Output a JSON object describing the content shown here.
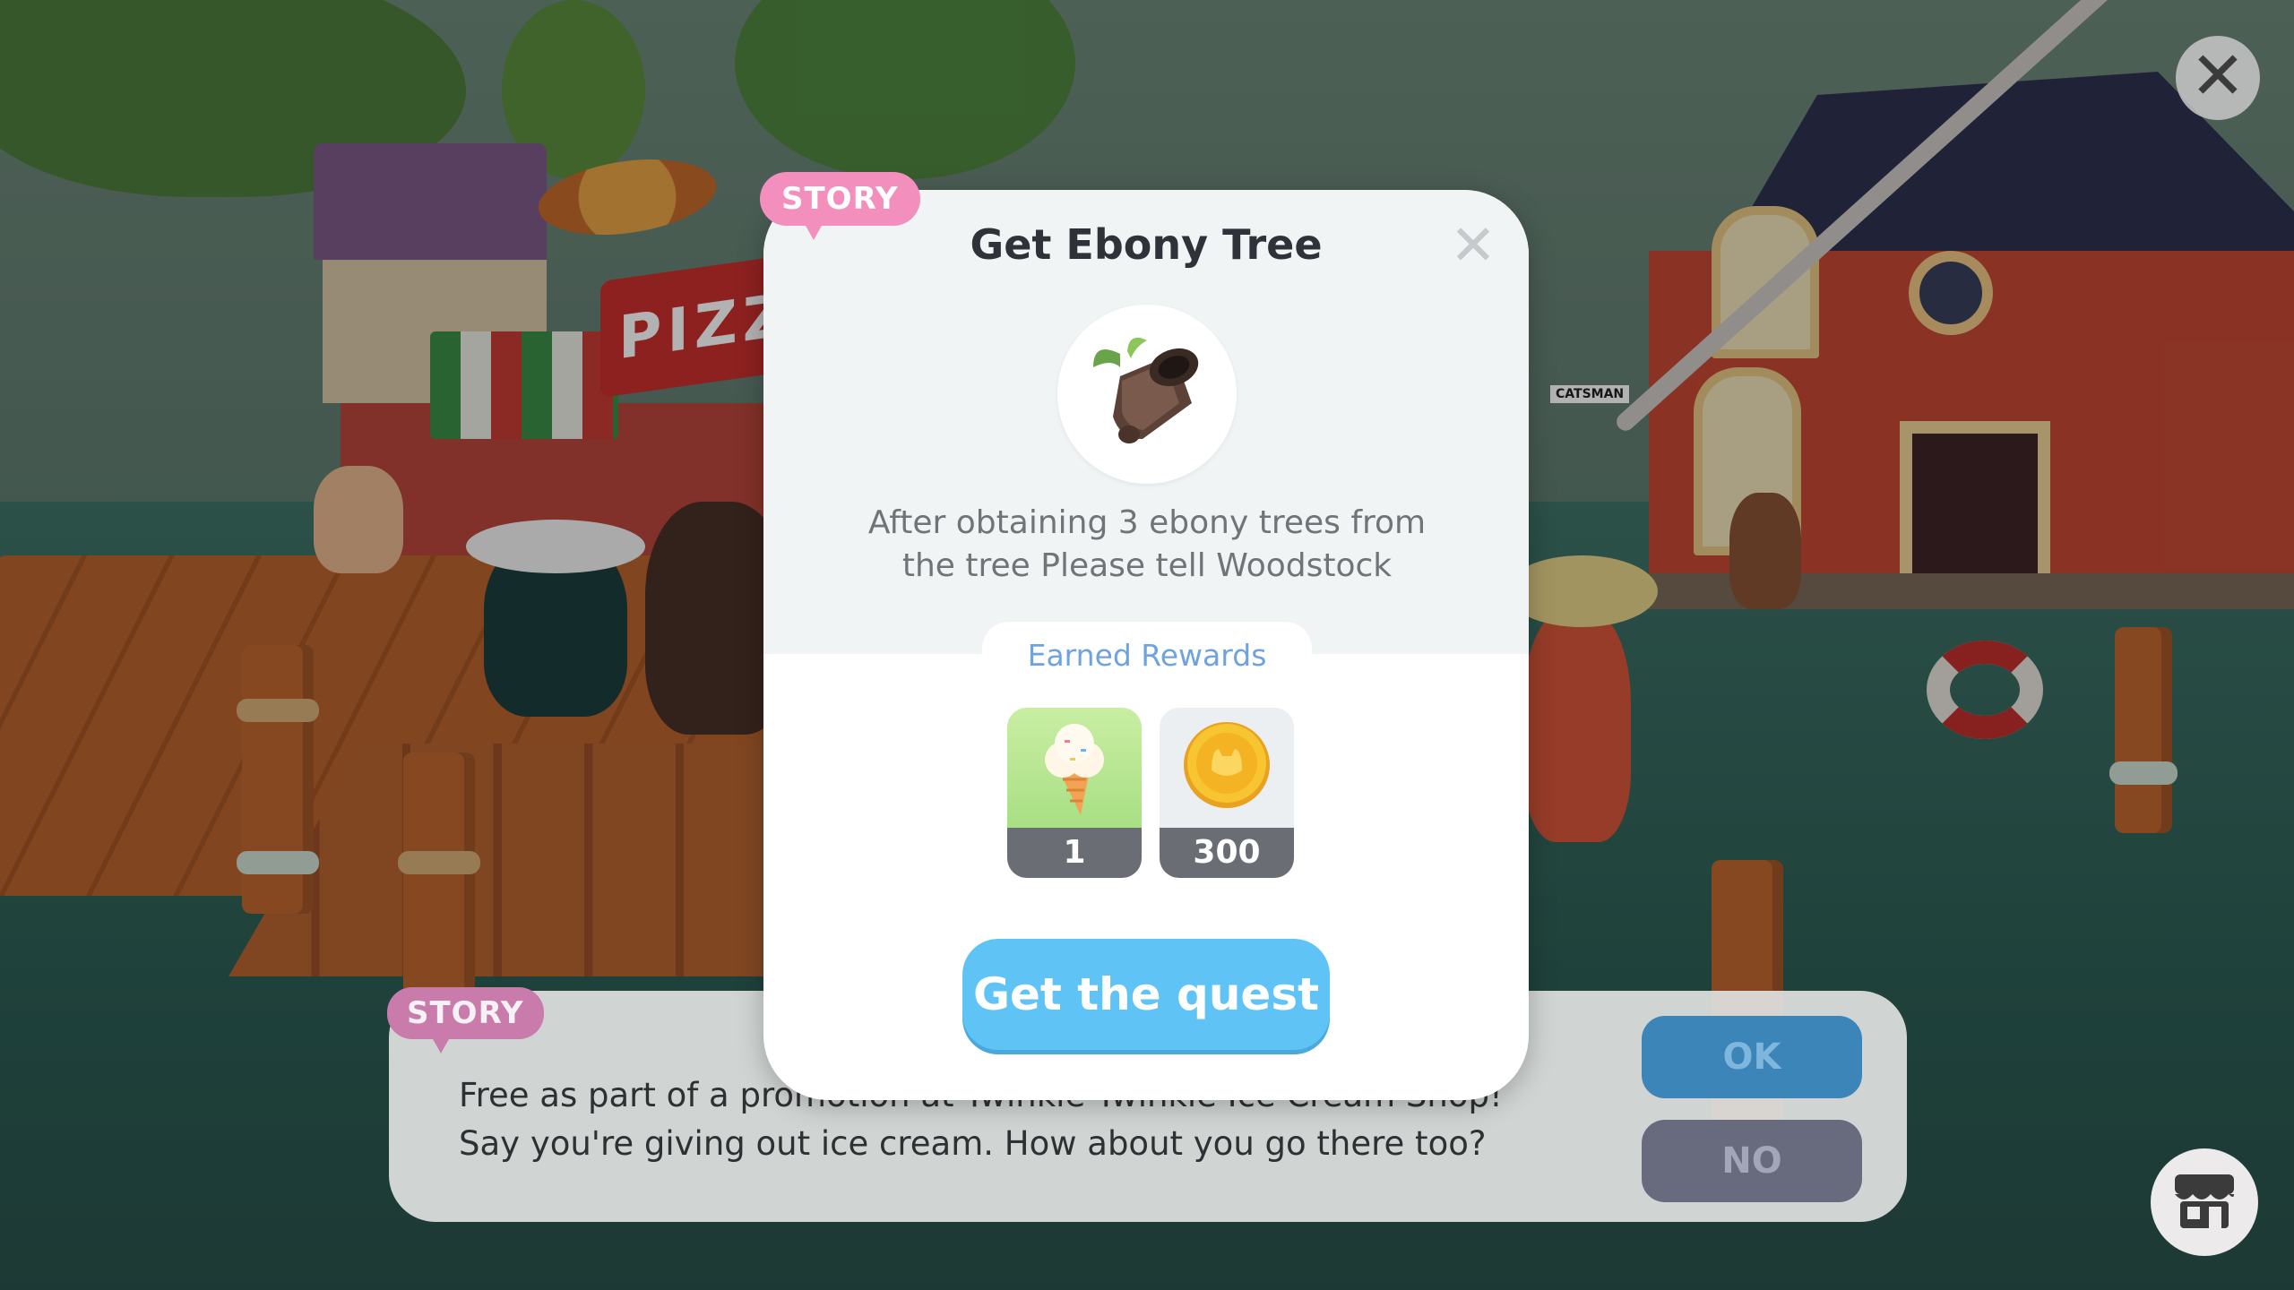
{
  "hud": {
    "close_icon": "close-icon",
    "shop_icon": "shop-icon"
  },
  "modal": {
    "tag": "STORY",
    "title": "Get Ebony Tree",
    "item_icon": "ebony-log-icon",
    "description_line1": "After obtaining 3 ebony trees from",
    "description_line2": "the tree Please tell Woodstock",
    "rewards_label": "Earned Rewards",
    "rewards": [
      {
        "icon": "ice-cream-icon",
        "count": "1"
      },
      {
        "icon": "gold-coin-icon",
        "count": "300"
      }
    ],
    "button_label": "Get the quest"
  },
  "story_dialog": {
    "tag": "STORY",
    "line1": "Free as part of a promotion at Twinkle Twinkle Ice Cream Shop!",
    "line2": "Say you're giving out ice cream. How about you go there too?",
    "ok_label": "OK",
    "no_label": "NO"
  },
  "scene": {
    "pizza_sign": "PIZZ",
    "shop_sign": "CATSMAN"
  },
  "colors": {
    "accent_blue": "#5fc3f5",
    "story_pink": "#f38fbd",
    "rewards_blue": "#6ea3e0"
  }
}
